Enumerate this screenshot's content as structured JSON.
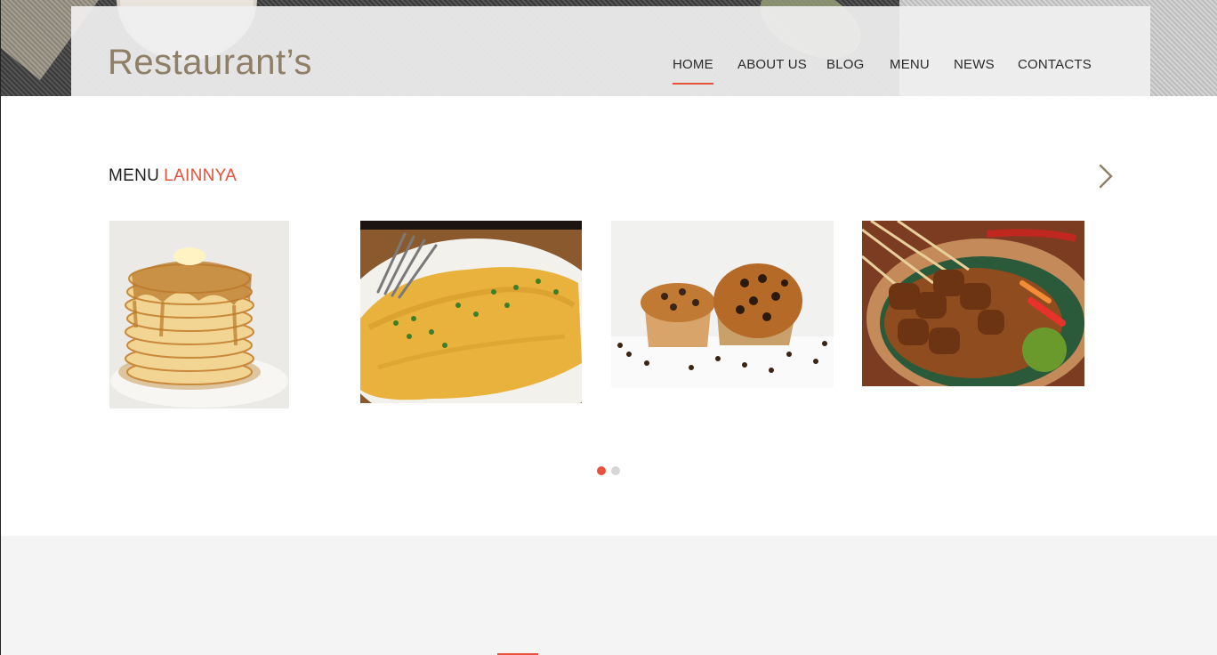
{
  "site": {
    "logo": "Restaurant’s"
  },
  "nav": {
    "items": [
      {
        "label": "HOME",
        "active": true
      },
      {
        "label": "ABOUT US",
        "active": false
      },
      {
        "label": "BLOG",
        "active": false
      },
      {
        "label": "MENU",
        "active": false
      },
      {
        "label": "NEWS",
        "active": false
      },
      {
        "label": "CONTACTS",
        "active": false
      }
    ]
  },
  "section": {
    "title_part1": "MENU",
    "title_part2": "LAINNYA",
    "next_icon": "chevron-right-icon"
  },
  "menu_items": [
    {
      "name": "pancakes"
    },
    {
      "name": "omelette"
    },
    {
      "name": "chocolate-chip-muffins"
    },
    {
      "name": "satay-skewers"
    }
  ],
  "pagination": {
    "total": 2,
    "active_index": 0
  },
  "colors": {
    "accent": "#e8513a",
    "logo": "#8e7f66",
    "text": "#2a2a2a",
    "dot_inactive": "#d6d6d6",
    "footer_bg": "#f4f4f4"
  }
}
